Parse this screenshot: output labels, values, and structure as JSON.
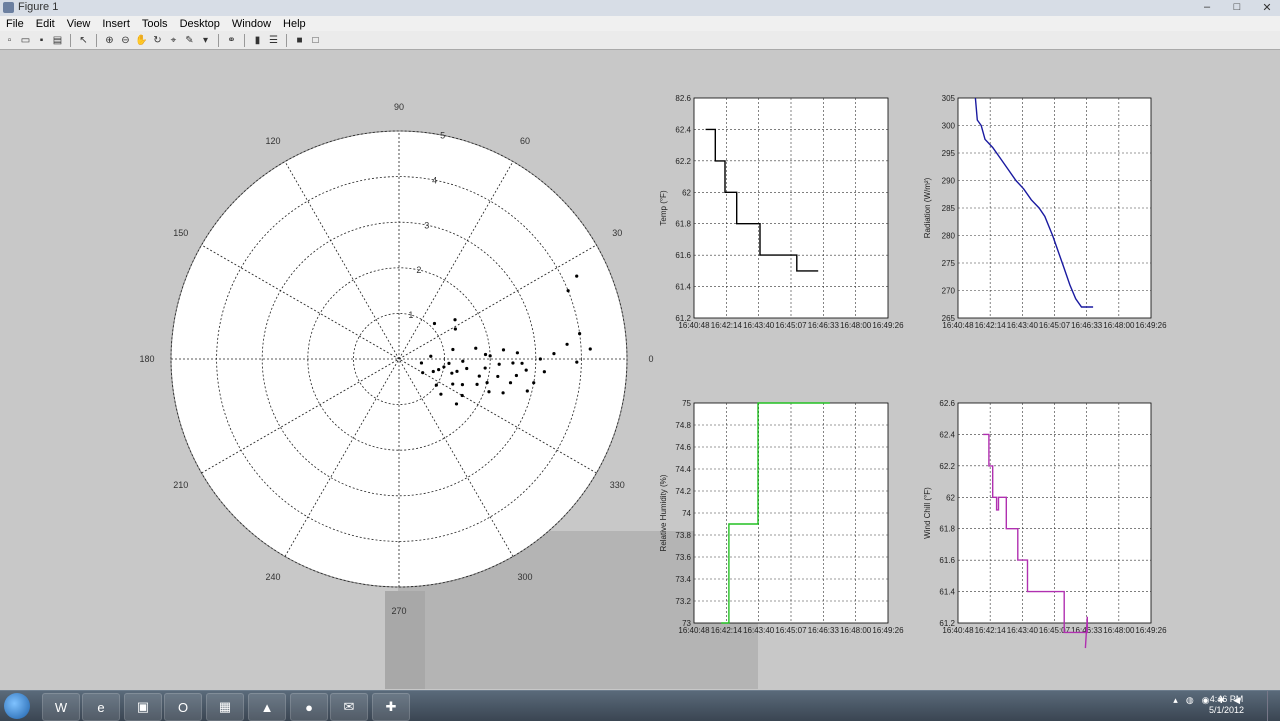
{
  "window": {
    "title": "Figure 1",
    "controls": [
      "–",
      "□",
      "✕"
    ]
  },
  "menu": [
    "File",
    "Edit",
    "View",
    "Insert",
    "Tools",
    "Desktop",
    "Window",
    "Help"
  ],
  "toolbar": {
    "buttons": [
      "new-figure",
      "open-file",
      "save-figure",
      "print-figure",
      "edit-plot",
      "zoom-in",
      "zoom-out",
      "pan",
      "rotate-3d",
      "data-cursor",
      "brush",
      "link-plot",
      "insert-colorbar",
      "insert-legend",
      "hide-plot-tools",
      "show-plot-tools"
    ]
  },
  "polar": {
    "angle_labels": [
      "90",
      "60",
      "30",
      "0",
      "330",
      "300",
      "270",
      "240",
      "210",
      "180",
      "150",
      "120"
    ],
    "radial_labels": [
      "1",
      "2",
      "3",
      "4",
      "5"
    ],
    "rmax": 5,
    "points": [
      [
        2.6,
        -8
      ],
      [
        2.5,
        -12
      ],
      [
        2.8,
        -5
      ],
      [
        3.0,
        -10
      ],
      [
        1.5,
        -8
      ],
      [
        1.8,
        -12
      ],
      [
        1.2,
        -15
      ],
      [
        2.2,
        -3
      ],
      [
        2.4,
        -18
      ],
      [
        1.9,
        -6
      ],
      [
        1.0,
        -10
      ],
      [
        0.8,
        -20
      ],
      [
        1.3,
        -25
      ],
      [
        1.6,
        -30
      ],
      [
        0.9,
        -15
      ],
      [
        1.1,
        -5
      ],
      [
        1.4,
        -2
      ],
      [
        2.0,
        -15
      ],
      [
        2.7,
        -2
      ],
      [
        3.2,
        -5
      ],
      [
        3.4,
        2
      ],
      [
        2.3,
        5
      ],
      [
        1.7,
        8
      ],
      [
        1.2,
        10
      ],
      [
        0.7,
        5
      ],
      [
        0.5,
        -10
      ],
      [
        0.6,
        -30
      ],
      [
        1.0,
        -35
      ],
      [
        1.5,
        -22
      ],
      [
        2.1,
        -20
      ],
      [
        2.9,
        -14
      ],
      [
        3.1,
        0
      ],
      [
        2.6,
        3
      ],
      [
        1.9,
        3
      ],
      [
        1.3,
        -12
      ],
      [
        1.8,
        -18
      ],
      [
        2.2,
        -10
      ],
      [
        2.5,
        -2
      ],
      [
        2.0,
        2
      ],
      [
        3.7,
        5
      ],
      [
        4.0,
        22
      ],
      [
        4.3,
        25
      ],
      [
        4.2,
        3
      ],
      [
        4.0,
        8
      ],
      [
        3.9,
        -1
      ],
      [
        1.1,
        45
      ],
      [
        1.5,
        35
      ],
      [
        1.4,
        28
      ],
      [
        1.2,
        -40
      ],
      [
        1.6,
        -38
      ]
    ]
  },
  "subplots": [
    {
      "name": "temp",
      "ylabel": "Temp (°F)",
      "color": "#000000",
      "yticks": [
        "82.6",
        "62.4",
        "62.2",
        "62",
        "61.8",
        "61.6",
        "61.4",
        "61.2"
      ],
      "xticks": [
        "16:40:48",
        "16:42:14",
        "16:43:40",
        "16:45:07",
        "16:46:33",
        "16:48:00",
        "16:49:26"
      ],
      "steps": [
        [
          0.06,
          1.0
        ],
        [
          0.11,
          1.0
        ],
        [
          0.11,
          2.0
        ],
        [
          0.16,
          2.0
        ],
        [
          0.16,
          3.0
        ],
        [
          0.22,
          3.0
        ],
        [
          0.22,
          4.0
        ],
        [
          0.34,
          4.0
        ],
        [
          0.34,
          5.0
        ],
        [
          0.53,
          5.0
        ],
        [
          0.53,
          5.5
        ],
        [
          0.64,
          5.5
        ]
      ]
    },
    {
      "name": "radiation",
      "ylabel": "Radiation (W/m²)",
      "color": "#1a1aa0",
      "yticks": [
        "305",
        "300",
        "295",
        "290",
        "285",
        "280",
        "275",
        "270",
        "265"
      ],
      "xticks": [
        "16:40:48",
        "16:42:14",
        "16:43:40",
        "16:45:07",
        "16:46:33",
        "16:48:00",
        "16:49:26"
      ],
      "steps": [
        [
          0.09,
          0.0
        ],
        [
          0.1,
          0.8
        ],
        [
          0.12,
          1.0
        ],
        [
          0.14,
          1.5
        ],
        [
          0.18,
          1.8
        ],
        [
          0.22,
          2.2
        ],
        [
          0.26,
          2.6
        ],
        [
          0.3,
          3.0
        ],
        [
          0.34,
          3.3
        ],
        [
          0.38,
          3.7
        ],
        [
          0.42,
          4.0
        ],
        [
          0.45,
          4.3
        ],
        [
          0.49,
          5.0
        ],
        [
          0.52,
          5.6
        ],
        [
          0.55,
          6.2
        ],
        [
          0.58,
          6.8
        ],
        [
          0.61,
          7.3
        ],
        [
          0.64,
          7.6
        ],
        [
          0.7,
          7.6
        ]
      ]
    },
    {
      "name": "humidity",
      "ylabel": "Relative Humidity (%)",
      "color": "#22c022",
      "yticks": [
        "75",
        "74.8",
        "74.6",
        "74.4",
        "74.2",
        "74",
        "73.8",
        "73.6",
        "73.4",
        "73.2",
        "73"
      ],
      "xticks": [
        "16:40:48",
        "16:42:14",
        "16:43:40",
        "16:45:07",
        "16:46:33",
        "16:48:00",
        "16:49:26"
      ],
      "steps": [
        [
          0.14,
          10.0
        ],
        [
          0.18,
          10.0
        ],
        [
          0.18,
          5.5
        ],
        [
          0.33,
          5.5
        ],
        [
          0.33,
          0.0
        ],
        [
          0.7,
          0.0
        ]
      ]
    },
    {
      "name": "wind-chill",
      "ylabel": "Wind Chill (°F)",
      "color": "#b030b0",
      "yticks": [
        "62.6",
        "62.4",
        "62.2",
        "62",
        "61.8",
        "61.6",
        "61.4",
        "61.2"
      ],
      "xticks": [
        "16:40:48",
        "16:42:14",
        "16:43:40",
        "16:45:07",
        "16:46:33",
        "16:48:00",
        "16:49:26"
      ],
      "steps": [
        [
          0.13,
          1.0
        ],
        [
          0.16,
          1.0
        ],
        [
          0.16,
          2.0
        ],
        [
          0.18,
          2.0
        ],
        [
          0.18,
          3.0
        ],
        [
          0.2,
          3.0
        ],
        [
          0.2,
          3.4
        ],
        [
          0.21,
          3.4
        ],
        [
          0.21,
          3.0
        ],
        [
          0.25,
          3.0
        ],
        [
          0.25,
          4.0
        ],
        [
          0.31,
          4.0
        ],
        [
          0.31,
          5.0
        ],
        [
          0.36,
          5.0
        ],
        [
          0.36,
          6.0
        ],
        [
          0.55,
          6.0
        ],
        [
          0.55,
          7.3
        ],
        [
          0.67,
          7.3
        ],
        [
          0.67,
          6.8
        ],
        [
          0.66,
          7.8
        ]
      ]
    }
  ],
  "taskbar": {
    "apps": [
      "start",
      "word",
      "ie",
      "explorer",
      "outlook",
      "image-viewer",
      "matlab",
      "media",
      "mail",
      "tools"
    ],
    "clock_time": "4:46 PM",
    "clock_date": "5/1/2012"
  }
}
